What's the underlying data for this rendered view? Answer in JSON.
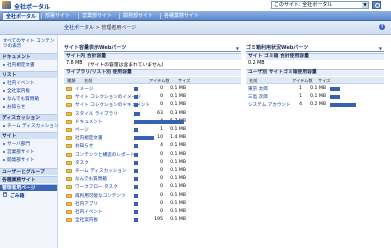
{
  "header": {
    "site_title": "全社ポータル",
    "search_scope": "このサイト: 全社ポータル"
  },
  "topnav": {
    "tabs": [
      "全社ポータル",
      "部署サイト",
      "営業部サイト",
      "開発部サイト",
      "各種業務サイト"
    ]
  },
  "breadcrumb": {
    "root": "全社ポータル",
    "sep": ">",
    "current": "管理者用ページ"
  },
  "leftnav": {
    "top_link": "すべてのサイト コンテンツの表示",
    "sections": [
      {
        "heading": "ドキュメント",
        "items": [
          "社内規定文書"
        ]
      },
      {
        "heading": "リスト",
        "items": [
          "社内イベント",
          "全社案内板",
          "なんでも質問箱",
          "お知らせ"
        ]
      },
      {
        "heading": "ディスカッション",
        "items": [
          "チーム ディスカッション"
        ]
      },
      {
        "heading": "サイト",
        "items": [
          "サーバ部門",
          "営業部サイト",
          "開発部サイト"
        ]
      },
      {
        "heading": "ユーザーとグループ",
        "items": []
      },
      {
        "heading": "各種業務サイト",
        "items": []
      },
      {
        "heading": "管理者用ページ",
        "items": []
      }
    ],
    "recycle_bin": "ごみ箱"
  },
  "left_webpart": {
    "title": "サイト容量表示Webパーツ",
    "total_heading": "サイト内 合計容量",
    "total_value": "7.8 MB",
    "total_note": "(サイトの容量は含まれていません)",
    "list_heading": "ライブラリ/リスト別 使用容量",
    "columns": [
      "種類",
      "名前",
      "アイテム数",
      "サイズ"
    ],
    "rows": [
      {
        "name": "イメージ",
        "count": "0",
        "size": "0.1 MB",
        "fraction": 0.08
      },
      {
        "name": "サイト コレクションのイメージ",
        "count": "0",
        "size": "0.1 MB",
        "fraction": 0.08
      },
      {
        "name": "サイト コレクションのドキュメント",
        "count": "0",
        "size": "0.1 MB",
        "fraction": 0.08
      },
      {
        "name": "スタイル ライブラリ",
        "count": "63",
        "size": "0.3 MB",
        "fraction": 0.12
      },
      {
        "name": "ドキュメント",
        "count": "4",
        "size": "5.7 MB",
        "fraction": 1.0
      },
      {
        "name": "ページ",
        "count": "1",
        "size": "0.1 MB",
        "fraction": 0.08
      },
      {
        "name": "社内規定文書",
        "count": "10",
        "size": "1.4 MB",
        "fraction": 0.4
      },
      {
        "name": "お知らせ",
        "count": "4",
        "size": "0.1 MB",
        "fraction": 0.08
      },
      {
        "name": "コンテンツと構造のレポート",
        "count": "0",
        "size": "0.1 MB",
        "fraction": 0.08
      },
      {
        "name": "タスク",
        "count": "0",
        "size": "0.1 MB",
        "fraction": 0.08
      },
      {
        "name": "チーム ディスカッション",
        "count": "0",
        "size": "0.1 MB",
        "fraction": 0.08
      },
      {
        "name": "なんでも質問箱",
        "count": "0",
        "size": "0.1 MB",
        "fraction": 0.08
      },
      {
        "name": "ワークフロー タスク",
        "count": "0",
        "size": "0.1 MB",
        "fraction": 0.08
      },
      {
        "name": "再利用可能なコンテンツ",
        "count": "0",
        "size": "0.1 MB",
        "fraction": 0.08
      },
      {
        "name": "社内アプリ",
        "count": "0",
        "size": "0.1 MB",
        "fraction": 0.08
      },
      {
        "name": "社内イベント",
        "count": "0",
        "size": "0.1 MB",
        "fraction": 0.08
      },
      {
        "name": "全社案内板",
        "count": "195",
        "size": "0.1 MB",
        "fraction": 0.08
      }
    ]
  },
  "right_webpart": {
    "title": "ゴミ箱利用状況Webパーツ",
    "total_heading": "サイト ゴミ箱 合計使用容量",
    "total_value": "0.2 MB",
    "user_heading": "ユーザ別 サイトゴミ箱使用容量",
    "columns": [
      "名前",
      "アイテム数",
      "サイズ"
    ],
    "rows": [
      {
        "name": "東京 太郎",
        "count": "1",
        "size": "0.1 MB",
        "fraction": 0.25
      },
      {
        "name": "三島 次郎",
        "count": "1",
        "size": "0.1 MB",
        "fraction": 0.25
      },
      {
        "name": "システム アカウント",
        "count": "4",
        "size": "0.2 MB",
        "fraction": 0.65
      }
    ]
  }
}
